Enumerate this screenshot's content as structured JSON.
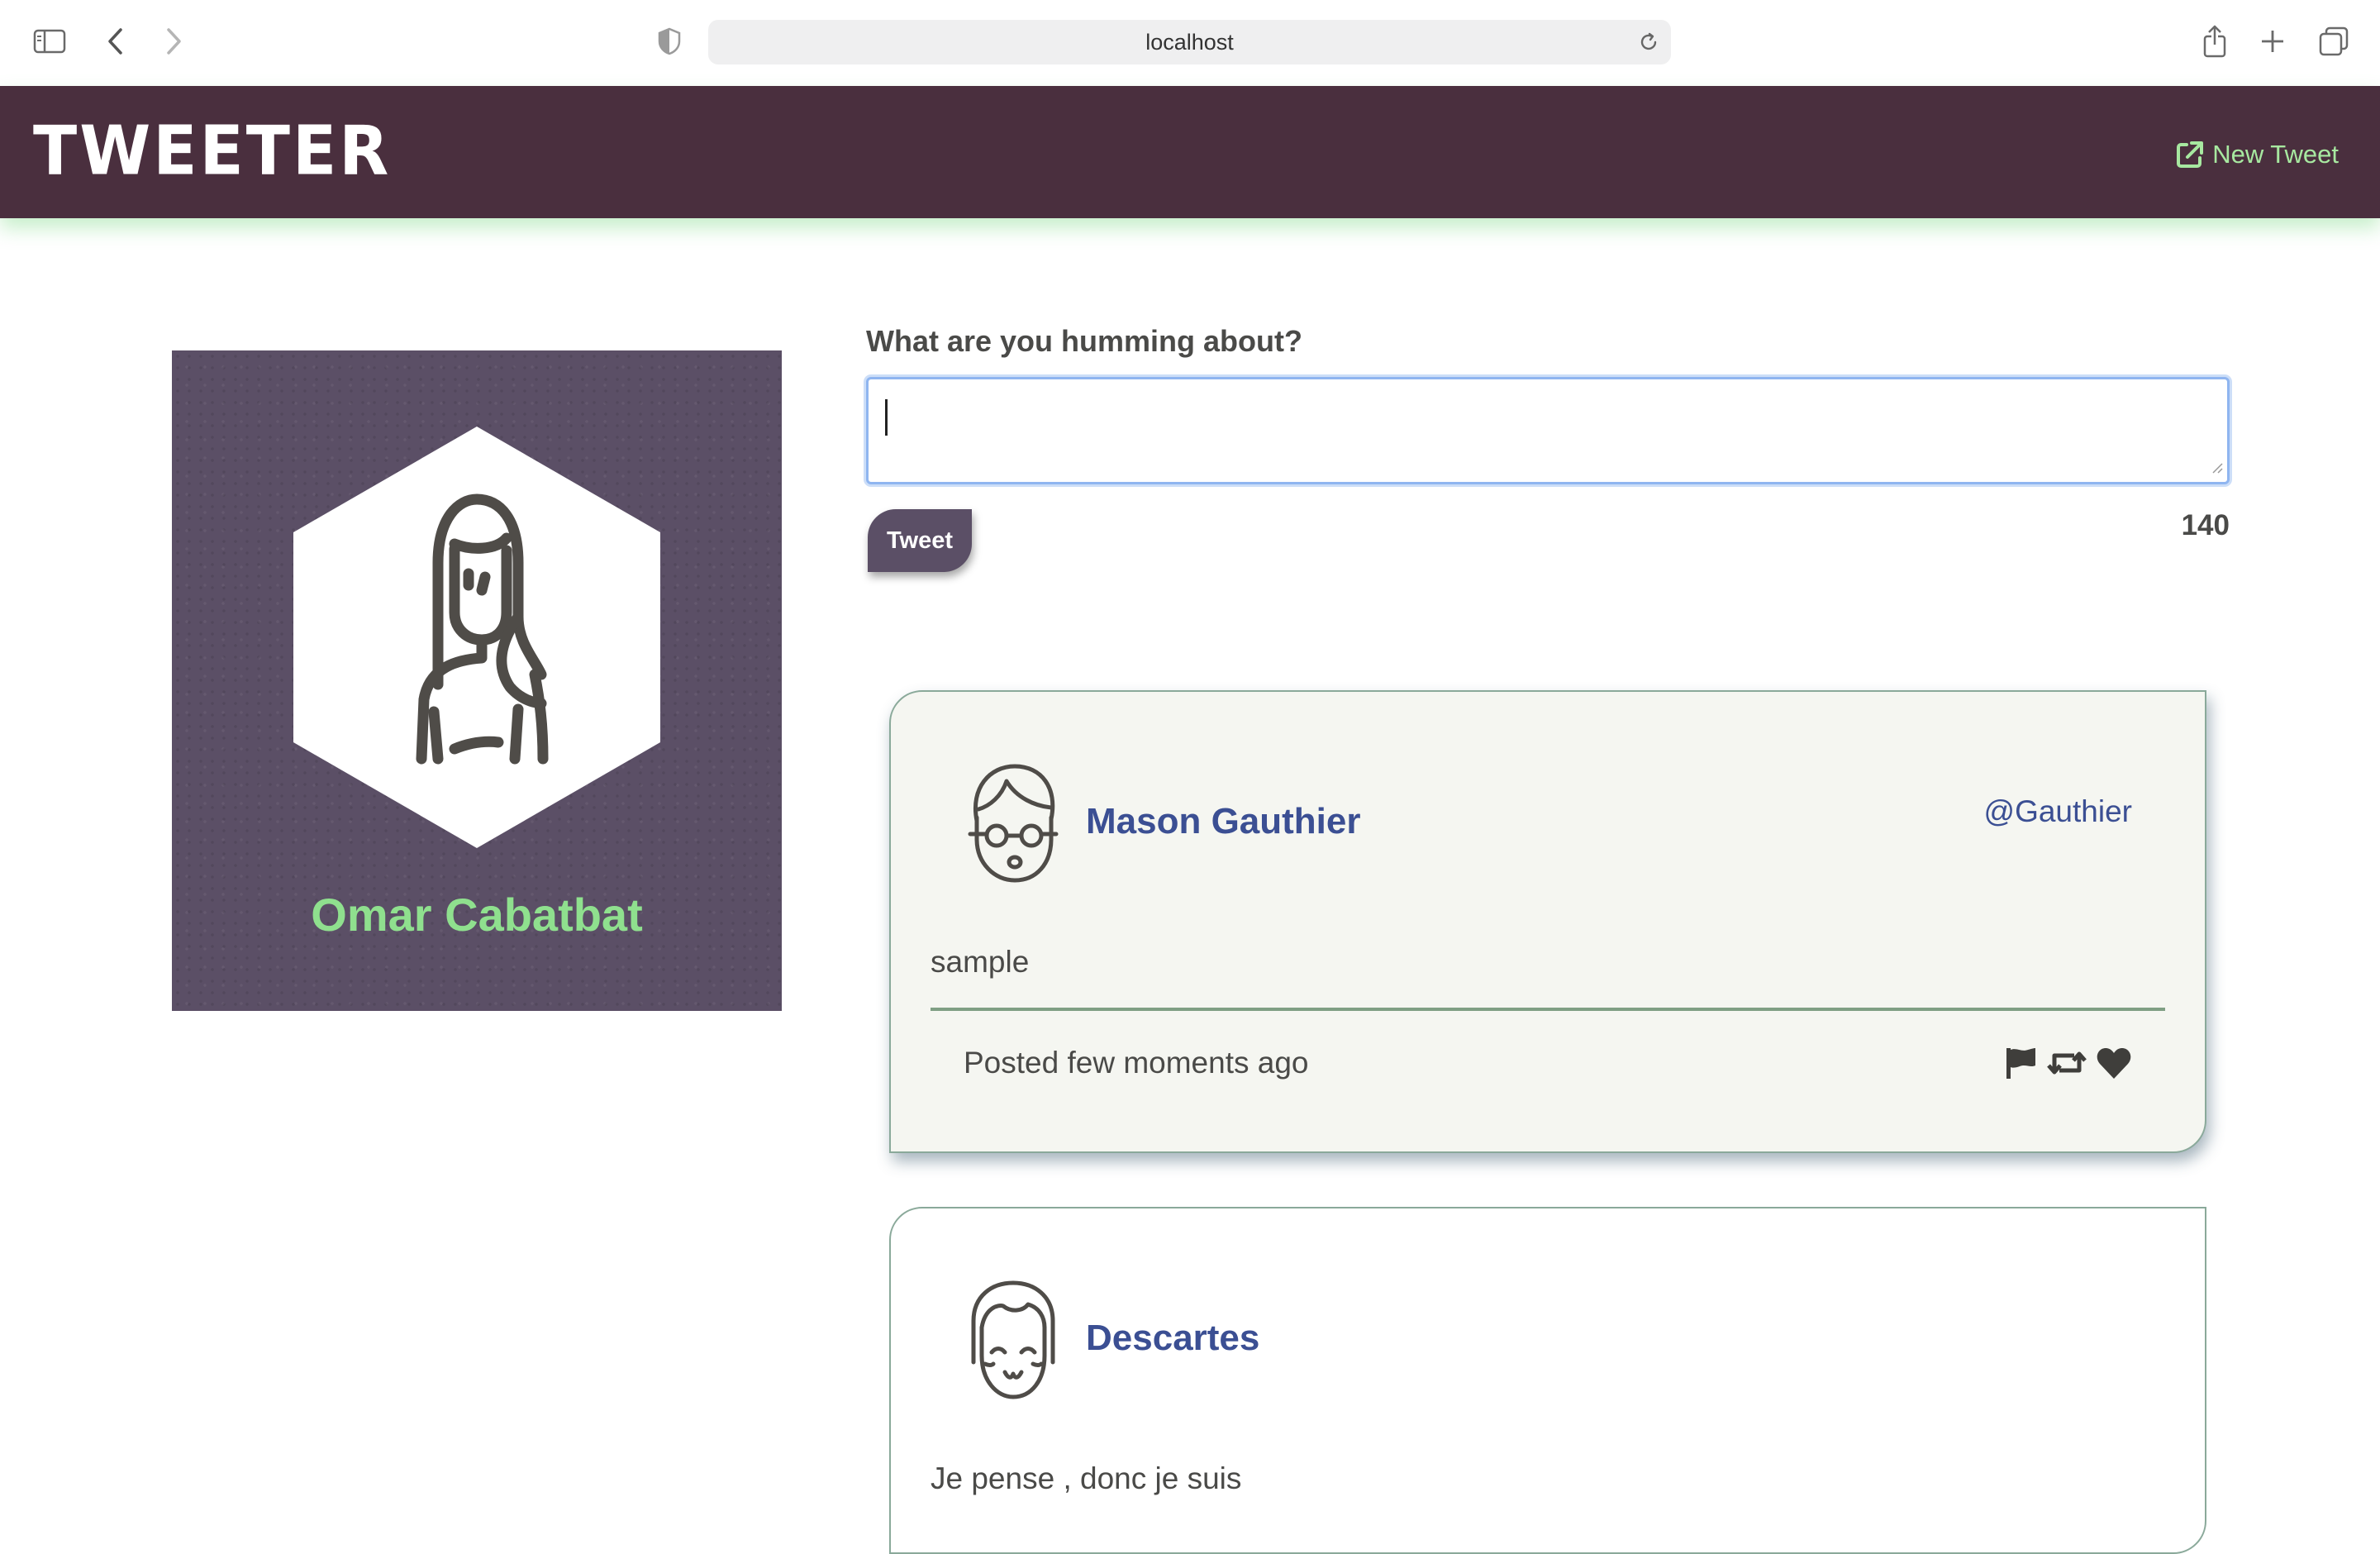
{
  "browser": {
    "url": "localhost"
  },
  "header": {
    "brand": "TWEETER",
    "new_tweet_label": "New Tweet"
  },
  "profile": {
    "name": "Omar Cabatbat"
  },
  "compose": {
    "label": "What are you humming about?",
    "value": "",
    "button_label": "Tweet",
    "counter": "140"
  },
  "tweets": [
    {
      "name": "Mason Gauthier",
      "handle": "@Gauthier",
      "text": "sample",
      "time": "Posted few moments ago"
    },
    {
      "name": "Descartes",
      "handle": "",
      "text": "Je pense , donc je suis"
    }
  ],
  "colors": {
    "header_bg": "#4a2f3e",
    "accent_green": "#8fe08e",
    "profile_bg": "#5b4f66",
    "name_blue": "#3b4f93"
  }
}
